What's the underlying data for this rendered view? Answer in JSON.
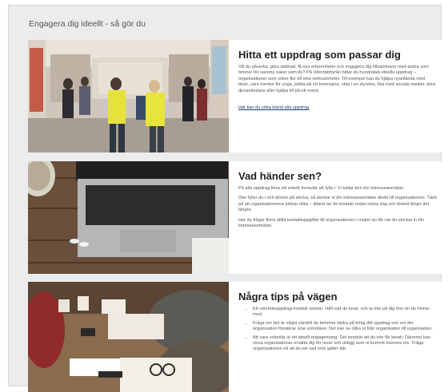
{
  "section": {
    "title": "Engagera dig ideellt - så gör du"
  },
  "cards": [
    {
      "heading": "Hitta ett uppdrag som passar dig",
      "paragraphs": [
        "Vill du påverka, göra skillnad, få nya erfarenheter och engagera dig tillsammans med andra som brinner för samma saker som du? På Volontärbyrån hittar du hundratals ideella uppdrag – organisationer som söker fler till sina verksamheter. Till exempel kan du hjälpa nyanlända med läxor, vara mentor för unga, jobba på ett kvinnojour, sitta i en styrelse, fixa med sociala medier, köra djurambulans eller hjälpa till på ett event."
      ],
      "link": "Här kan du söka bland alla uppdrag",
      "image_vest_text": "FRÅGA OSS OM VOLONTÄR-UPPDRAG"
    },
    {
      "heading": "Vad händer sen?",
      "paragraphs": [
        "På alla uppdrag finns ett enkelt formulär att fylla i. Vi kallar den din intresseanmälan.",
        "Den fyller du i och klickar på skicka, så skickar vi din intresseanmälan direkt till organisationen. Tänk på att organisationerna jobbar olika – ibland tar de kontakt redan nästa dag och ibland dröjer det längre.",
        "Har du frågor finns alltid kontaktuppgifter till organisationen i mejlet du får när du skickat in din intresseanmälan."
      ]
    },
    {
      "heading": "Några tips på vägen",
      "bullets": [
        "Ett volontäruppdrag innebär ansvar. Håll vad du lovar, och ta inte på dig mer än du hinner med.",
        "Fråga om det är något särskilt du behöver tänka på kring ditt uppdrag och om din organisation försäkrar sina volontärer. Det kan se olika ut från organisation till organisation.",
        "Att vara volontär är ett ideellt engagemang. Det innebär att du inte får betalt. Däremot kan vissa organisationer ersätta dig för resor och utlägg som ni kommit överens om. Fråga organisationen så att du vet vad som gäller där."
      ]
    }
  ]
}
